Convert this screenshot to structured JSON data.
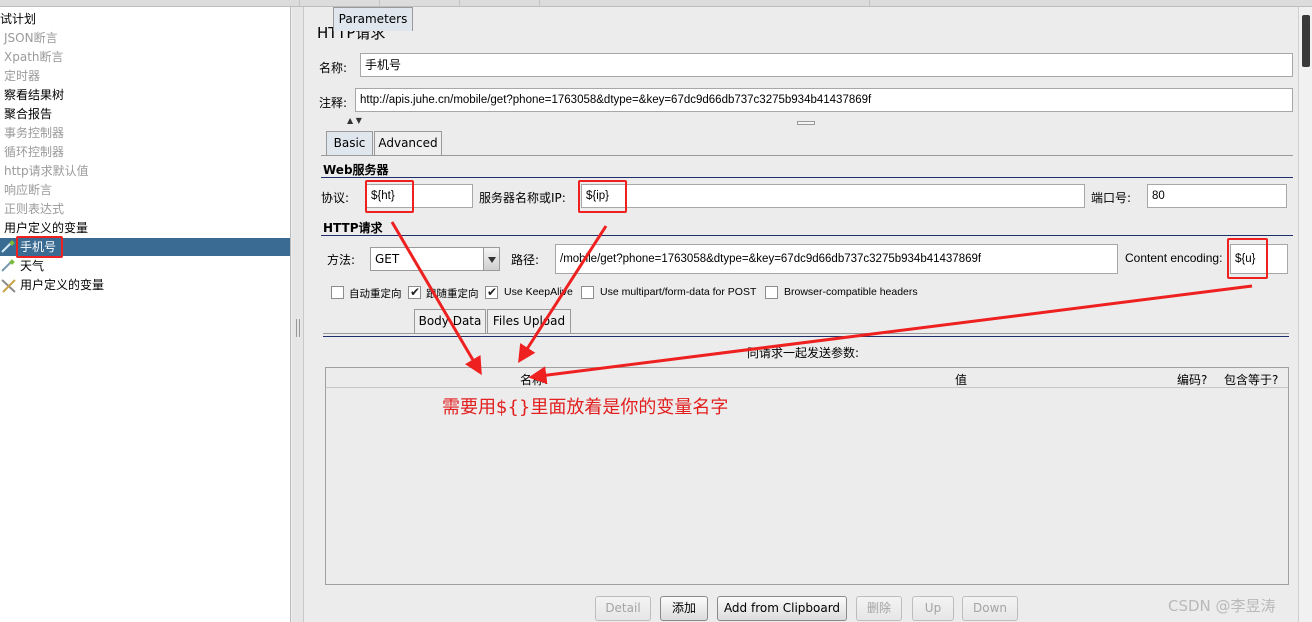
{
  "tree": {
    "items": [
      {
        "label": "试计划",
        "dim": false
      },
      {
        "label": "JSON断言",
        "dim": true
      },
      {
        "label": "Xpath断言",
        "dim": true
      },
      {
        "label": "定时器",
        "dim": true
      },
      {
        "label": "察看结果树",
        "dim": false
      },
      {
        "label": "聚合报告",
        "dim": false
      },
      {
        "label": "事务控制器",
        "dim": true
      },
      {
        "label": "循环控制器",
        "dim": true
      },
      {
        "label": "http请求默认值",
        "dim": true
      },
      {
        "label": "响应断言",
        "dim": true
      },
      {
        "label": "正则表达式",
        "dim": true
      },
      {
        "label": "用户定义的变量",
        "dim": false
      },
      {
        "label": "手机号",
        "dim": false,
        "selected": true
      },
      {
        "label": "天气",
        "dim": false
      },
      {
        "label": "用户定义的变量",
        "dim": false
      }
    ]
  },
  "panel": {
    "title": "HTTP请求",
    "name_label": "名称:",
    "name_value": "手机号",
    "comment_label": "注释:",
    "comment_value": "http://apis.juhe.cn/mobile/get?phone=1763058&dtype=&key=67dc9d66db737c3275b934b41437869f",
    "tabs": [
      "Basic",
      "Advanced"
    ],
    "web_server": {
      "section_title": "Web服务器",
      "protocol_label": "协议:",
      "protocol_value": "${ht}",
      "server_label": "服务器名称或IP:",
      "server_value": "${ip}",
      "port_label": "端口号:",
      "port_value": "80"
    },
    "http_request": {
      "section_title": "HTTP请求",
      "method_label": "方法:",
      "method_value": "GET",
      "path_label": "路径:",
      "path_value": "/mobile/get?phone=1763058&dtype=&key=67dc9d66db737c3275b934b41437869f",
      "encoding_label": "Content encoding:",
      "encoding_value": "${u}"
    },
    "options": [
      {
        "label": "自动重定向",
        "checked": false
      },
      {
        "label": "跟随重定向",
        "checked": true
      },
      {
        "label": "Use KeepAlive",
        "checked": true
      },
      {
        "label": "Use multipart/form-data for POST",
        "checked": false
      },
      {
        "label": "Browser-compatible headers",
        "checked": false
      }
    ],
    "sub_tabs": [
      "Parameters",
      "Body Data",
      "Files Upload"
    ],
    "params_caption": "同请求一起发送参数:",
    "table_headers": [
      "名称:",
      "值",
      "编码?",
      "包含等于?"
    ],
    "buttons": [
      {
        "label": "Detail",
        "enabled": false
      },
      {
        "label": "添加",
        "enabled": true
      },
      {
        "label": "Add from Clipboard",
        "enabled": true
      },
      {
        "label": "删除",
        "enabled": false
      },
      {
        "label": "Up",
        "enabled": false
      },
      {
        "label": "Down",
        "enabled": false
      }
    ]
  },
  "annotation": {
    "text": "需要用${}里面放着是你的变量名字",
    "color": "#e22020"
  },
  "watermark": "CSDN @李昱涛",
  "colors": {
    "selection": "#3a6b93",
    "separator": "#1f2f6b",
    "highlight": "#ee2020"
  },
  "icons": {
    "sampler": "pipette-icon",
    "config": "tools-icon"
  }
}
